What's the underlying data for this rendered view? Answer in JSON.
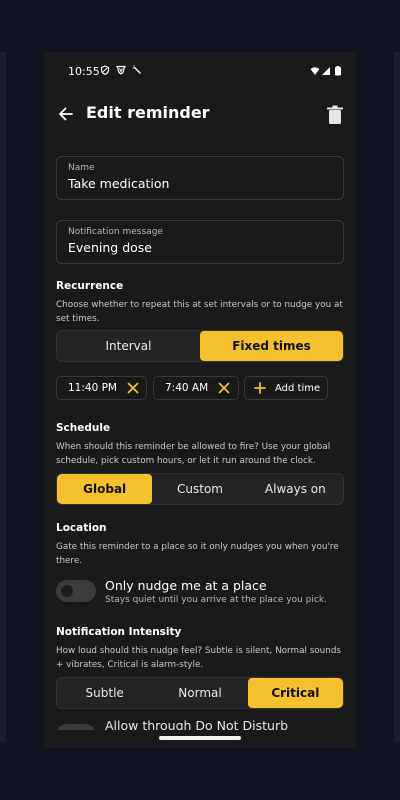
{
  "status_bar": {
    "time": "10:55"
  },
  "header": {
    "title": "Edit reminder"
  },
  "name_field": {
    "label": "Name",
    "value": "Take medication"
  },
  "message_field": {
    "label": "Notification message",
    "value": "Evening dose"
  },
  "recurrence": {
    "title": "Recurrence",
    "description": "Choose whether to repeat this at set intervals or to nudge you at set times.",
    "options": [
      "Interval",
      "Fixed times"
    ],
    "selected": "Fixed times",
    "times": [
      "11:40 PM",
      "7:40 AM"
    ],
    "add_time_label": "Add time"
  },
  "schedule": {
    "title": "Schedule",
    "description": "When should this reminder be allowed to fire? Use your global schedule, pick custom hours, or let it run around the clock.",
    "options": [
      "Global",
      "Custom",
      "Always on"
    ],
    "selected": "Global"
  },
  "location": {
    "title": "Location",
    "description": "Gate this reminder to a place so it only nudges you when you're there.",
    "toggle_label": "Only nudge me at a place",
    "toggle_sub": "Stays quiet until you arrive at the place you pick.",
    "toggle_on": false
  },
  "intensity": {
    "title": "Notification Intensity",
    "description": "How loud should this nudge feel? Subtle is silent, Normal sounds + vibrates, Critical is alarm-style.",
    "options": [
      "Subtle",
      "Normal",
      "Critical"
    ],
    "selected": "Critical",
    "dnd_label": "Allow through Do Not Disturb"
  },
  "colors": {
    "accent": "#f4c02e",
    "surface": "#1a1a1a",
    "background": "#0f1320"
  },
  "icons": {
    "back": "arrow-left-icon",
    "delete": "trash-icon",
    "remove_time": "x-icon",
    "add_time": "plus-icon"
  }
}
